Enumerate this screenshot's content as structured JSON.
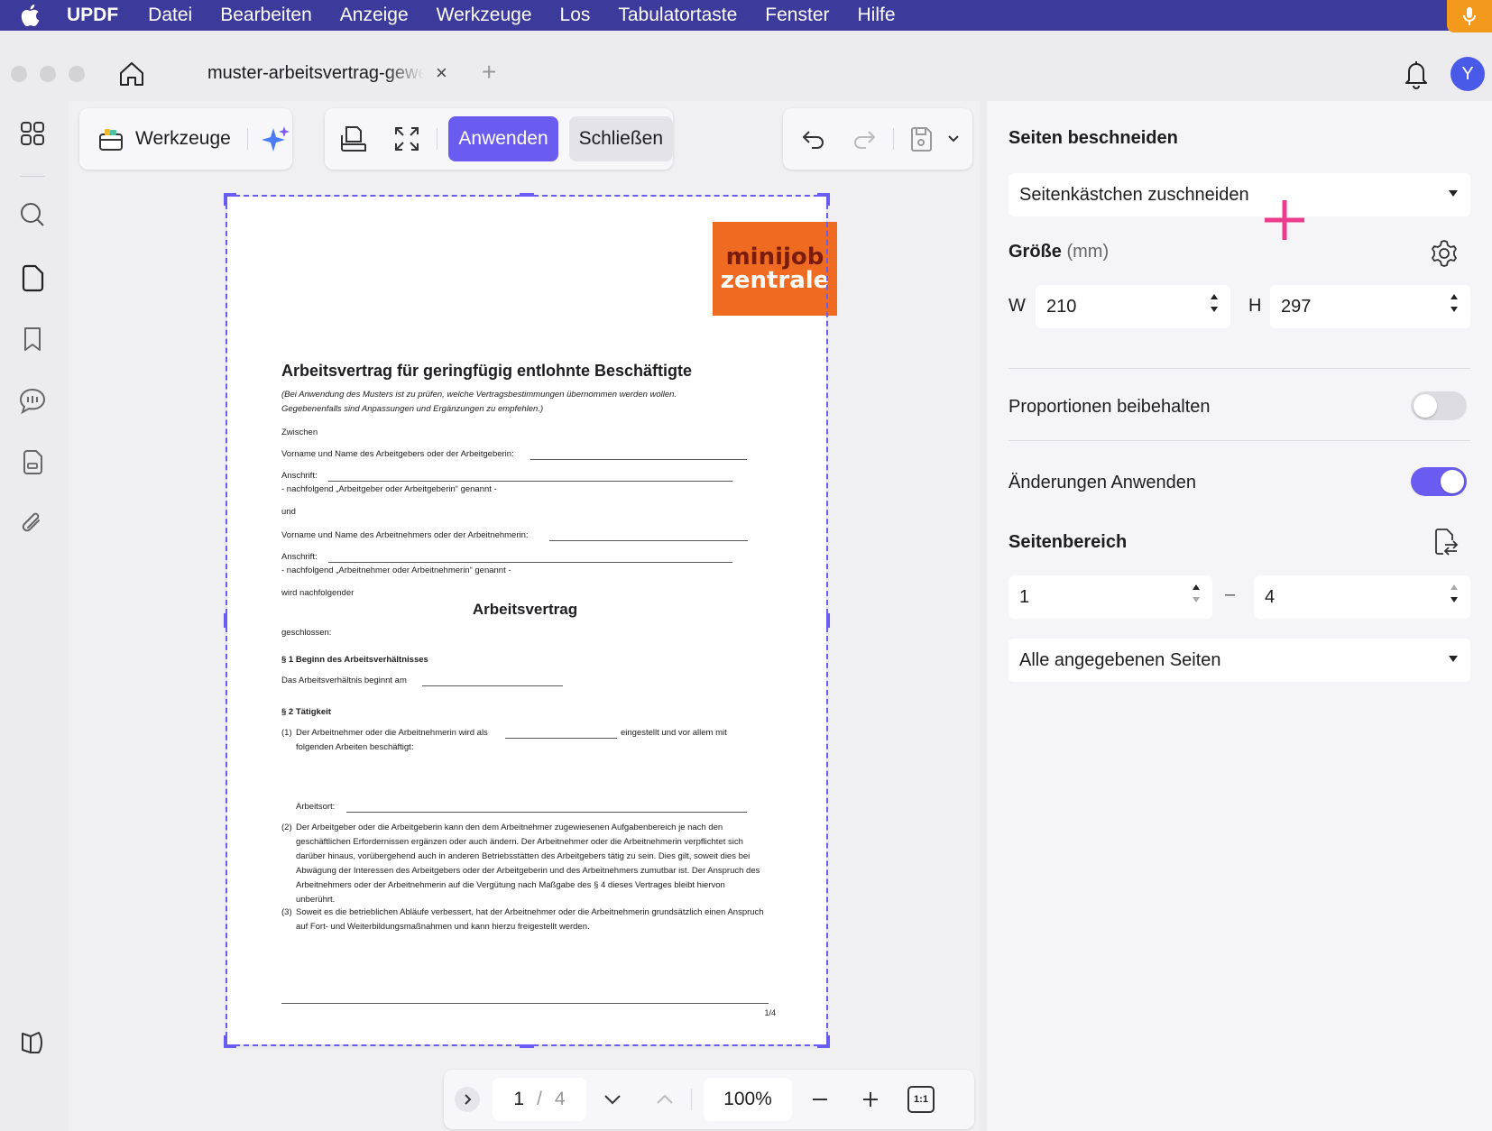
{
  "menubar": {
    "items": [
      "UPDF",
      "Datei",
      "Bearbeiten",
      "Anzeige",
      "Werkzeuge",
      "Los",
      "Tabulatortaste",
      "Fenster",
      "Hilfe"
    ]
  },
  "tab": {
    "title": "muster-arbeitsvertrag-gewerblich.pdf",
    "close": "×",
    "add": "+"
  },
  "user": {
    "avatar_letter": "Y"
  },
  "toolbar": {
    "tools_label": "Werkzeuge",
    "apply_label": "Anwenden",
    "close_label": "Schließen"
  },
  "document": {
    "logo_line1": "minijob",
    "logo_line2": "zentrale",
    "title": "Arbeitsvertrag für geringfügig entlohnte Beschäftigte",
    "subtitle": "(Bei Anwendung des Musters ist zu prüfen, welche Vertragsbestimmungen übernommen werden wollen. Gegebenenfalls sind Anpassungen und Ergänzungen zu empfehlen.)",
    "zwischen": "Zwischen",
    "employer_name": "Vorname und Name des Arbeitgebers oder der Arbeitgeberin:",
    "address1": "Anschrift:",
    "employer_note": "- nachfolgend „Arbeitgeber oder Arbeitgeberin“ genannt -",
    "und": "und",
    "employee_name": "Vorname und Name des Arbeitnehmers oder der Arbeitnehmerin:",
    "address2": "Anschrift:",
    "employee_note": "- nachfolgend „Arbeitnehmer oder Arbeitnehmerin“ genannt -",
    "following": "wird nachfolgender",
    "heading": "Arbeitsvertrag",
    "concluded": "geschlossen:",
    "s1_title": "§ 1 Beginn des Arbeitsverhältnisses",
    "s1_text": "Das Arbeitsverhältnis beginnt am",
    "s2_title": "§ 2 Tätigkeit",
    "p1_num": "(1)",
    "p1_a": "Der Arbeitnehmer oder die Arbeitnehmerin wird als",
    "p1_b": "eingestellt und vor allem mit",
    "p1_c": "folgenden Arbeiten beschäftigt:",
    "workplace": "Arbeitsort:",
    "p2_num": "(2)",
    "p2_text": "Der Arbeitgeber oder die Arbeitgeberin kann den dem Arbeitnehmer zugewiesenen Aufgabenbereich je nach den geschäftlichen Erfordernissen ergänzen oder auch ändern. Der Arbeitnehmer oder die Arbeitnehmerin verpflichtet sich darüber hinaus, vorübergehend auch in anderen Betriebsstätten des Arbeitgebers tätig zu sein. Dies gilt, soweit dies bei Abwägung der Interessen des Arbeitgebers oder der Arbeitgeberin und des Arbeitnehmers zumutbar ist. Der Anspruch des Arbeitnehmers oder der Arbeitnehmerin auf die Vergütung nach Maßgabe des § 4 dieses Vertrages bleibt hiervon unberührt.",
    "p3_num": "(3)",
    "p3_text": "Soweit es die betrieblichen Abläufe verbessert, hat der Arbeitnehmer oder die Arbeitnehmerin grundsätzlich einen Anspruch auf Fort- und Weiterbildungsmaßnahmen und kann hierzu freigestellt werden.",
    "page_label": "1/4"
  },
  "navigation": {
    "current_page": "1",
    "separator": "/",
    "total_pages": "4",
    "zoom": "100%",
    "fit_label": "1:1"
  },
  "panel": {
    "crop_title": "Seiten beschneiden",
    "crop_mode": "Seitenkästchen zuschneiden",
    "size_title": "Größe",
    "size_unit": "(mm)",
    "w_label": "W",
    "w_value": "210",
    "h_label": "H",
    "h_value": "297",
    "keep_ratio_label": "Proportionen beibehalten",
    "keep_ratio_on": false,
    "apply_changes_label": "Änderungen Anwenden",
    "apply_changes_on": true,
    "range_title": "Seitenbereich",
    "range_from": "1",
    "range_dash": "–",
    "range_to": "4",
    "range_mode": "Alle angegebenen Seiten"
  },
  "colors": {
    "accent": "#6a5cf0",
    "menubar": "#3c3a9a",
    "logo": "#f06b22",
    "crosshair": "#ec3a8c"
  }
}
